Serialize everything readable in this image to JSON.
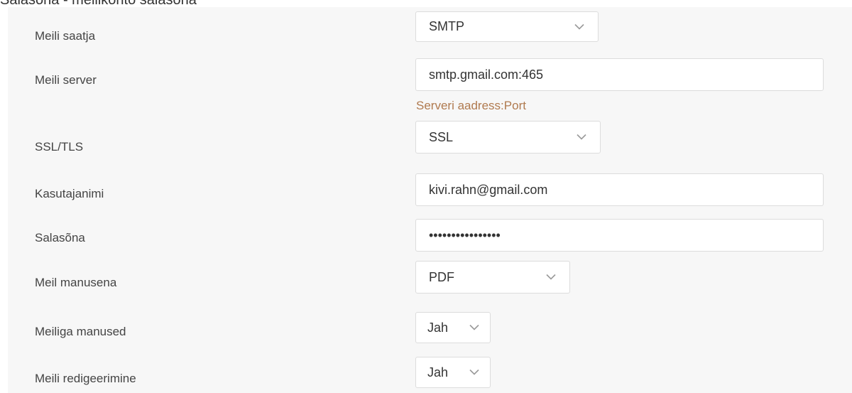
{
  "page_title": "Salasõna - meilikonto salasõna",
  "form": {
    "mail_sender": {
      "label": "Meili saatja",
      "value": "SMTP"
    },
    "mail_server": {
      "label": "Meili server",
      "value": "smtp.gmail.com:465",
      "hint": "Serveri aadress:Port"
    },
    "ssl_tls": {
      "label": "SSL/TLS",
      "value": "SSL"
    },
    "username": {
      "label": "Kasutajanimi",
      "value": "kivi.rahn@gmail.com"
    },
    "password": {
      "label": "Salasõna",
      "value": "••••••••••••••••"
    },
    "mail_attachment": {
      "label": "Meil manusena",
      "value": "PDF"
    },
    "mail_with_attachments": {
      "label": "Meiliga manused",
      "value": "Jah"
    },
    "mail_editing": {
      "label": "Meili redigeerimine",
      "value": "Jah"
    }
  },
  "icons": {
    "dropdown": "chevron-down-icon"
  },
  "colors": {
    "hint": "#b07a4f",
    "panel_bg": "#f7f7f7",
    "border": "#dcdcdc"
  }
}
